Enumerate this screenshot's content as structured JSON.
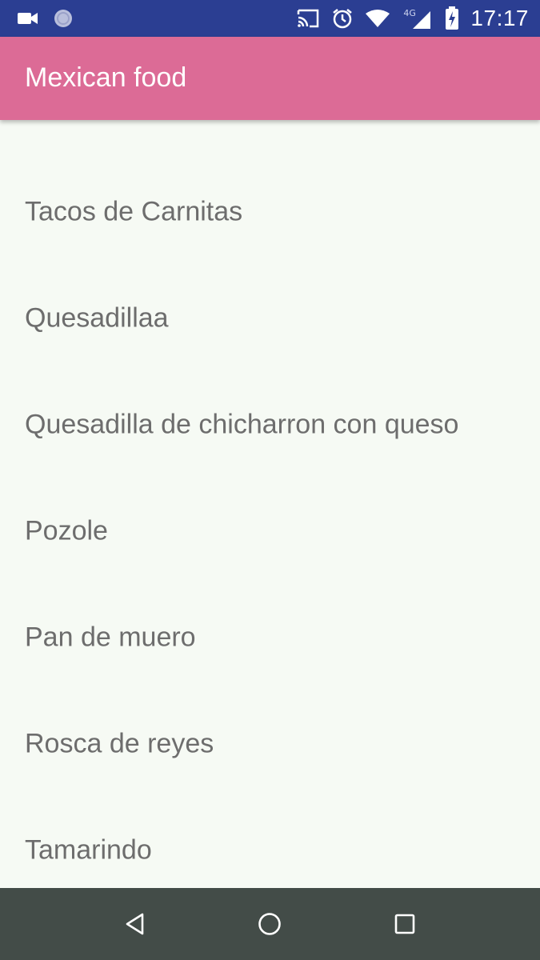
{
  "colors": {
    "status_bar": "#2b3e92",
    "app_bar": "#dc6b96",
    "background": "#f6faf4",
    "item_text": "#6d6d6d",
    "nav_bar": "#434c48"
  },
  "status_bar": {
    "left_icons": [
      "video-camera-icon",
      "circle-notification-icon"
    ],
    "right_icons": [
      "cast-icon",
      "alarm-icon",
      "wifi-icon",
      "signal-icon",
      "battery-charging-icon"
    ],
    "network_type": "4G",
    "time": "17:17"
  },
  "app_bar": {
    "title": "Mexican food"
  },
  "food_list": {
    "items": [
      "Tacos de Carnitas",
      "Quesadillaa",
      "Quesadilla de chicharron con queso",
      "Pozole",
      "Pan de muero",
      "Rosca de reyes",
      "Tamarindo"
    ]
  },
  "nav_bar": {
    "buttons": [
      "back-icon",
      "home-icon",
      "recents-icon"
    ]
  }
}
